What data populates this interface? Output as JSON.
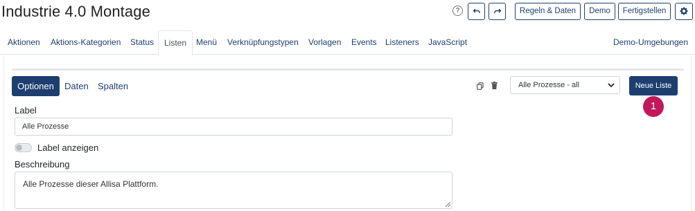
{
  "header": {
    "title": "Industrie 4.0 Montage",
    "help_symbol": "?",
    "undo_icon": "undo-icon",
    "redo_icon": "redo-icon",
    "rules_label": "Regeln & Daten",
    "demo_label": "Demo",
    "finish_label": "Fertigstellen",
    "settings_icon": "gear-icon"
  },
  "tabs": [
    {
      "label": "Aktionen"
    },
    {
      "label": "Aktions-Kategorien"
    },
    {
      "label": "Status"
    },
    {
      "label": "Listen",
      "active": true
    },
    {
      "label": "Menü"
    },
    {
      "label": "Verknüpfungstypen"
    },
    {
      "label": "Vorlagen"
    },
    {
      "label": "Events"
    },
    {
      "label": "Listeners"
    },
    {
      "label": "JavaScript"
    }
  ],
  "tabs_right": "Demo-Umgebungen",
  "subtabs": {
    "options": "Optionen",
    "data": "Daten",
    "columns": "Spalten"
  },
  "list_select": {
    "value": "Alle Prozesse - all"
  },
  "new_list_label": "Neue Liste",
  "callout_number": "1",
  "form": {
    "label_title": "Label",
    "label_value": "Alle Prozesse",
    "show_label_text": "Label anzeigen",
    "show_label_on": false,
    "description_title": "Beschreibung",
    "description_value": "Alle Prozesse dieser Allisa Plattform."
  },
  "colors": {
    "primary": "#1d3f70",
    "callout": "#c2185b"
  }
}
